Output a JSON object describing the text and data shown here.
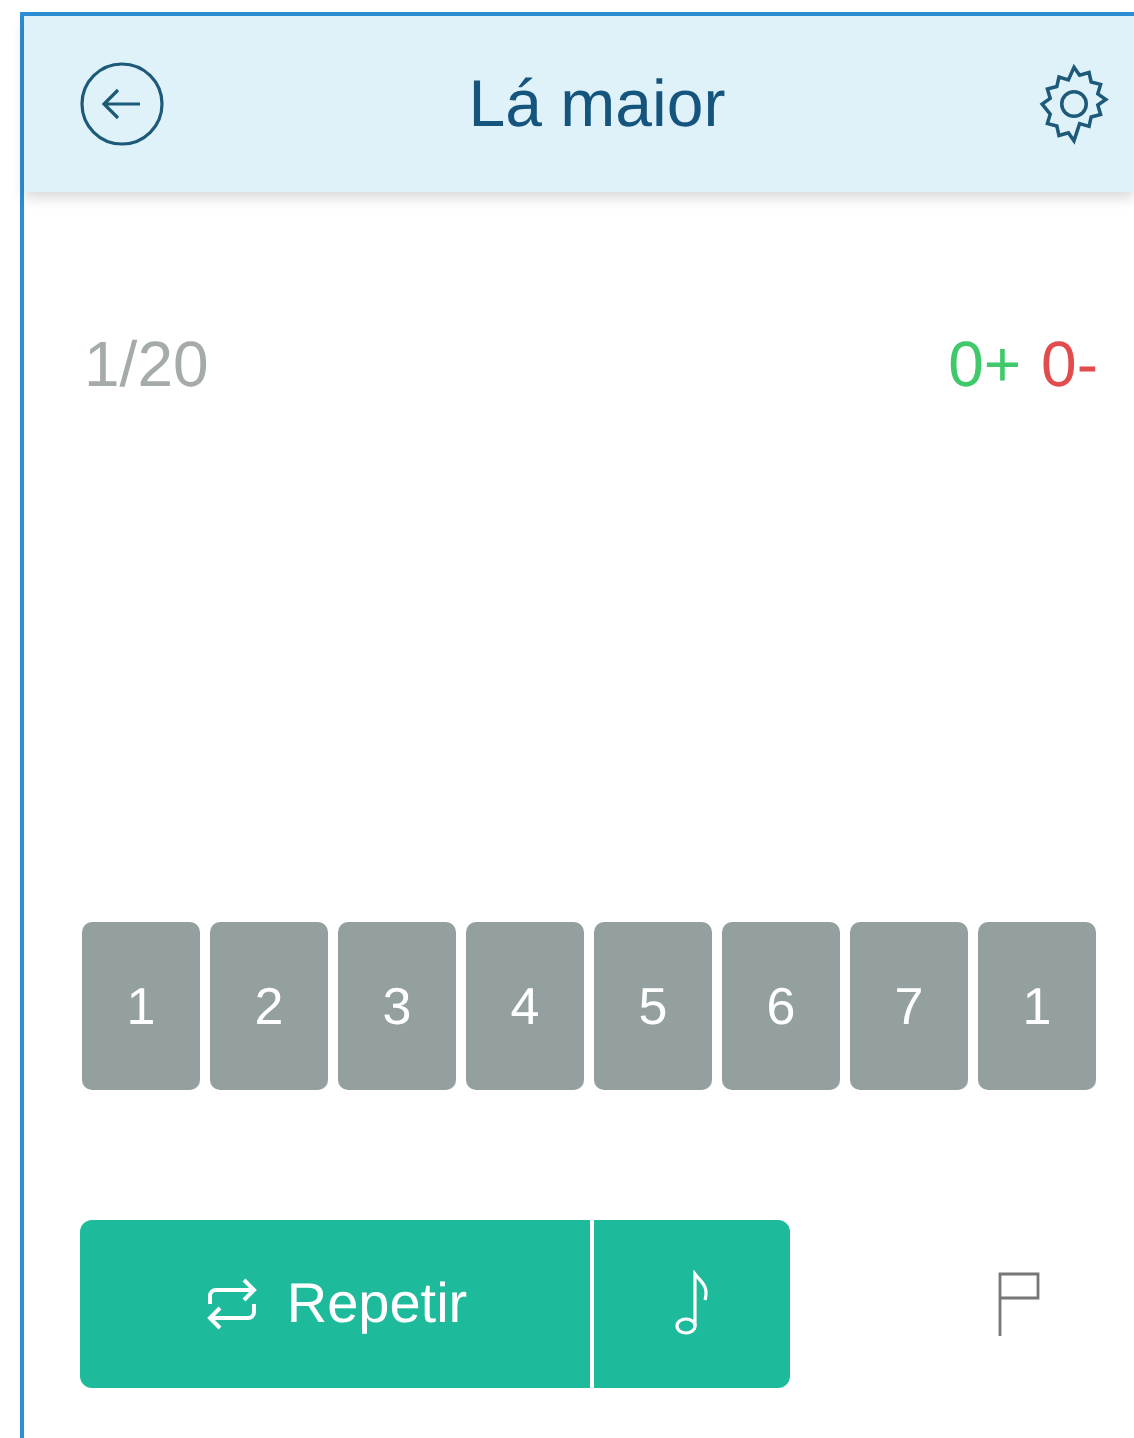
{
  "header": {
    "title": "Lá maior"
  },
  "progress": "1/20",
  "score": {
    "correct": "0+",
    "wrong": "0-"
  },
  "keys": [
    "1",
    "2",
    "3",
    "4",
    "5",
    "6",
    "7",
    "1"
  ],
  "actions": {
    "repeat": "Repetir"
  }
}
